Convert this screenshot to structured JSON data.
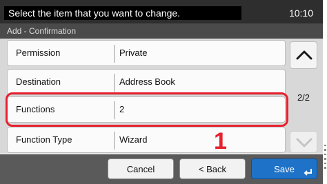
{
  "header": {
    "message": "Select the item that you want to change.",
    "time": "10:10",
    "subtitle": "Add - Confirmation"
  },
  "rows": [
    {
      "label": "Permission",
      "value": "Private"
    },
    {
      "label": "Destination",
      "value": "Address Book"
    },
    {
      "label": "Functions",
      "value": "2"
    },
    {
      "label": "Function Type",
      "value": "Wizard"
    }
  ],
  "page_indicator": "2/2",
  "callout_number": "1",
  "buttons": {
    "cancel": "Cancel",
    "back": "< Back",
    "save": "Save"
  },
  "icons": {
    "scroll_up": "chevron-up-icon",
    "scroll_down": "chevron-down-icon",
    "save_enter": "enter-icon"
  },
  "colors": {
    "highlight": "#e8202e",
    "save_button": "#1e73c8"
  }
}
